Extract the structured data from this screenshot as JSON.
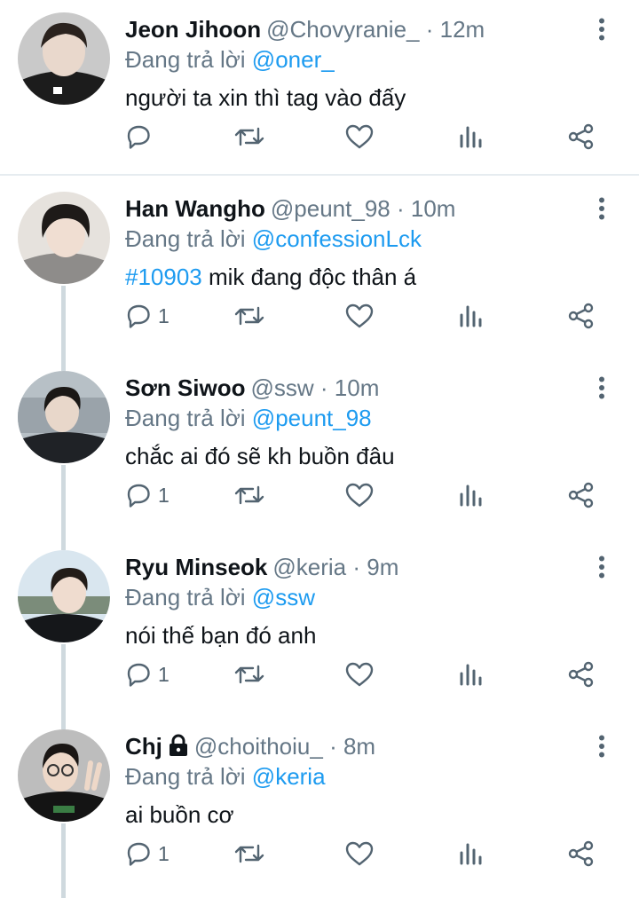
{
  "tweets": [
    {
      "name": "Jeon Jihoon",
      "handle": "@Chovyranie_",
      "time": "12m",
      "replying_prefix": "Đang trả lời",
      "replying_to": "@oner_",
      "hashtag": "",
      "text": "người ta xin thì tag vào đấy",
      "reply_count": "",
      "locked": false
    },
    {
      "name": "Han Wangho",
      "handle": "@peunt_98",
      "time": "10m",
      "replying_prefix": "Đang trả lời",
      "replying_to": "@confessionLck",
      "hashtag": "#10903",
      "text": " mik đang độc thân á",
      "reply_count": "1",
      "locked": false
    },
    {
      "name": "Sơn Siwoo",
      "handle": "@ssw",
      "time": "10m",
      "replying_prefix": "Đang trả lời",
      "replying_to": "@peunt_98",
      "hashtag": "",
      "text": "chắc ai đó sẽ kh buồn đâu",
      "reply_count": "1",
      "locked": false
    },
    {
      "name": "Ryu Minseok",
      "handle": "@keria",
      "time": "9m",
      "replying_prefix": "Đang trả lời",
      "replying_to": "@ssw",
      "hashtag": "",
      "text": "nói thế bạn đó anh",
      "reply_count": "1",
      "locked": false
    },
    {
      "name": "Chj",
      "handle": "@choithoiu_",
      "time": "8m",
      "replying_prefix": "Đang trả lời",
      "replying_to": "@keria",
      "hashtag": "",
      "text": "ai buồn cơ",
      "reply_count": "1",
      "locked": true
    }
  ],
  "separator": "·",
  "icons": {
    "more": "more-vertical-icon",
    "reply": "reply-icon",
    "retweet": "retweet-icon",
    "like": "heart-icon",
    "views": "views-icon",
    "share": "share-icon",
    "lock": "lock-icon"
  },
  "colors": {
    "accent": "#1d9bf0",
    "secondary_text": "#657786",
    "icon": "#536471",
    "thread_line": "#cfd9de",
    "divider": "#e6ecf0"
  }
}
